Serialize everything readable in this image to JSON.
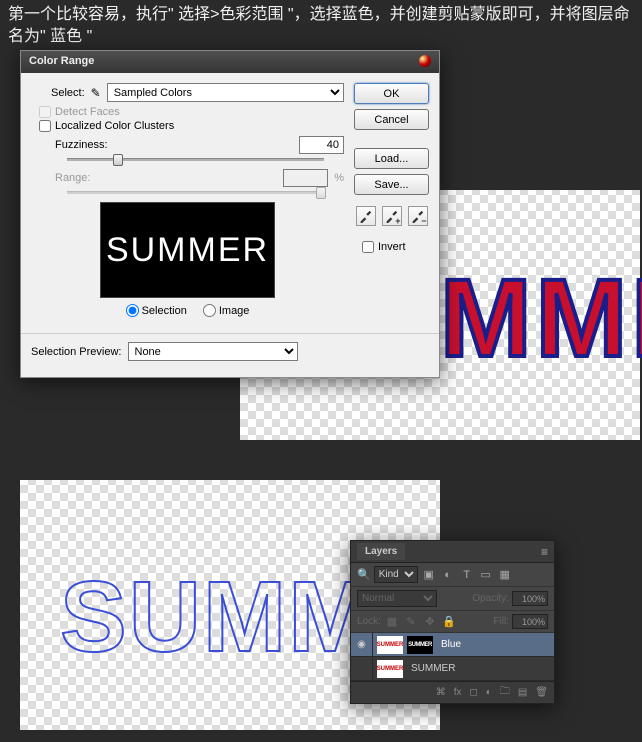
{
  "instruction": "第一个比较容易，执行\" 选择>色彩范围 \"，选择蓝色，并创建剪贴蒙版即可，并将图层命名为\" 蓝色 \"",
  "canvas1_text": "MME",
  "canvas2_text": "SUMM",
  "dialog": {
    "title": "Color Range",
    "select_label": "Select:",
    "select_value": "Sampled Colors",
    "detect_faces": "Detect Faces",
    "localized": "Localized Color Clusters",
    "fuzziness_label": "Fuzziness:",
    "fuzziness_value": "40",
    "range_label": "Range:",
    "range_unit": "%",
    "preview_text": "SUMMER",
    "radio_selection": "Selection",
    "radio_image": "Image",
    "preview_label": "Selection Preview:",
    "preview_value": "None",
    "ok": "OK",
    "cancel": "Cancel",
    "load": "Load...",
    "save": "Save...",
    "invert": "Invert"
  },
  "layers": {
    "title": "Layers",
    "kind": "Kind",
    "blend": "Normal",
    "opacity_label": "Opacity:",
    "opacity_value": "100%",
    "lock_label": "Lock:",
    "fill_label": "Fill:",
    "fill_value": "100%",
    "rows": [
      {
        "name": "Blue",
        "hasMask": true,
        "visible": true
      },
      {
        "name": "SUMMER",
        "hasMask": false,
        "visible": false
      }
    ]
  }
}
